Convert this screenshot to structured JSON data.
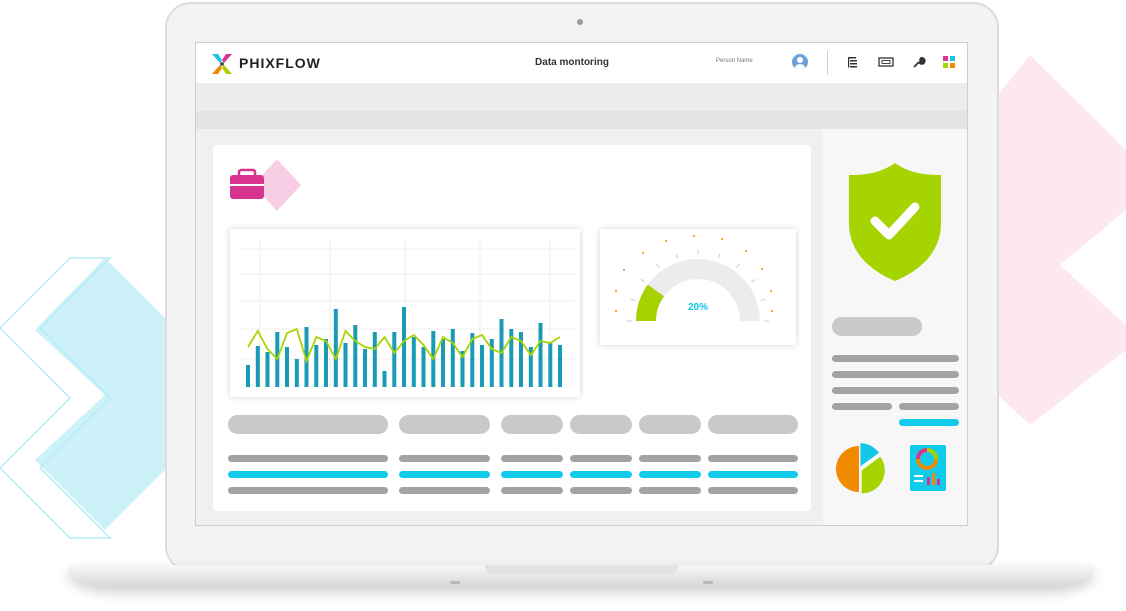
{
  "header": {
    "brand": "PHIXFLOW",
    "title": "Data montoring",
    "person_name": "Person Name"
  },
  "toolbar_icons": [
    "list-icon",
    "monitor-icon",
    "wrench-icon",
    "apps-icon"
  ],
  "colors": {
    "bar": "#1a9bb5",
    "line": "#a9d400",
    "gauge_fill": "#a6d300",
    "accent_cyan": "#12cbea",
    "shield": "#a6d400",
    "briefcase": "#d8348f",
    "pie_orange": "#f18a00",
    "pie_green": "#a6d300",
    "pie_cyan": "#12c6e8"
  },
  "chart_data": [
    {
      "type": "bar",
      "values": [
        22,
        41,
        35,
        55,
        40,
        28,
        60,
        42,
        48,
        78,
        44,
        62,
        38,
        55,
        16,
        55,
        80,
        50,
        40,
        56,
        48,
        58,
        36,
        54,
        42,
        48,
        68,
        58,
        55,
        40,
        64,
        45,
        42
      ],
      "overlay_line": [
        40,
        56,
        38,
        28,
        54,
        58,
        26,
        50,
        46,
        28,
        56,
        46,
        40,
        38,
        50,
        34,
        46,
        52,
        42,
        28,
        50,
        44,
        30,
        48,
        52,
        38,
        34,
        50,
        46,
        32,
        46,
        44,
        50
      ]
    },
    {
      "type": "gauge",
      "value": 0.2,
      "value_label": "20%"
    },
    {
      "type": "pie",
      "values": [
        50,
        35,
        15
      ]
    }
  ]
}
